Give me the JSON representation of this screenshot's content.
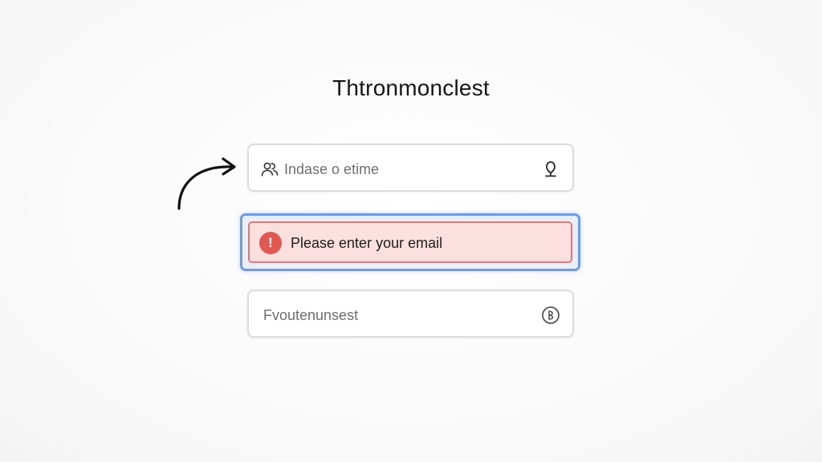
{
  "header": {
    "title": "Thtronmonclest"
  },
  "form": {
    "top_field": {
      "value": "Indase o etime",
      "lead_icon": "users-icon",
      "trail_icon": "microphone-icon"
    },
    "error": {
      "message": "Please enter your email",
      "icon": "alert-icon",
      "icon_glyph": "!"
    },
    "bottom_field": {
      "value": "Fvoutenunsest",
      "trail_icon": "info-circle-icon"
    }
  },
  "annotation": {
    "arrow_icon": "curved-arrow-icon"
  },
  "colors": {
    "error_fill": "#fbe0df",
    "error_border": "#e07a77",
    "focus_ring": "#6f9be3",
    "error_icon_bg": "#e15852"
  }
}
